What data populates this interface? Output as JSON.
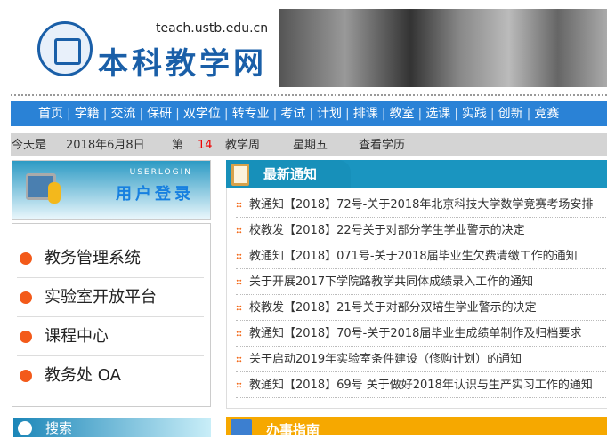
{
  "header": {
    "url": "teach.ustb.edu.cn",
    "site_name": "本科教学网"
  },
  "nav": [
    "首页",
    "学籍",
    "交流",
    "保研",
    "双学位",
    "转专业",
    "考试",
    "计划",
    "排课",
    "教室",
    "选课",
    "实践",
    "创新",
    "竞赛"
  ],
  "datebar": {
    "today_label": "今天是",
    "date": "2018年6月8日",
    "week_prefix": "第",
    "week_num": "14",
    "week_suffix": "教学周",
    "weekday": "星期五",
    "calendar_link": "查看学历"
  },
  "login": {
    "en": "USERLOGIN",
    "cn": "用户登录"
  },
  "links": [
    "教务管理系统",
    "实验室开放平台",
    "课程中心",
    "教务处 OA"
  ],
  "search": {
    "title": "搜索"
  },
  "notice": {
    "title": "最新通知",
    "items": [
      "教通知【2018】72号-关于2018年北京科技大学数学竞赛考场安排",
      "校教发【2018】22号关于对部分学生学业警示的决定",
      "教通知【2018】071号-关于2018届毕业生欠费清缴工作的通知",
      "关于开展2017下学院路教学共同体成绩录入工作的通知",
      "校教发【2018】21号关于对部分双培生学业警示的决定",
      "教通知【2018】70号-关于2018届毕业生成绩单制作及归档要求",
      "关于启动2019年实验室条件建设（修购计划）的通知",
      "教通知【2018】69号 关于做好2018年认识与生产实习工作的通知"
    ]
  },
  "guide": {
    "title": "办事指南"
  },
  "colors": {
    "nav": "#2a82d6",
    "notice_head": "#1a95c0",
    "guide_head": "#f6a800",
    "accent_red": "#ee0000"
  }
}
